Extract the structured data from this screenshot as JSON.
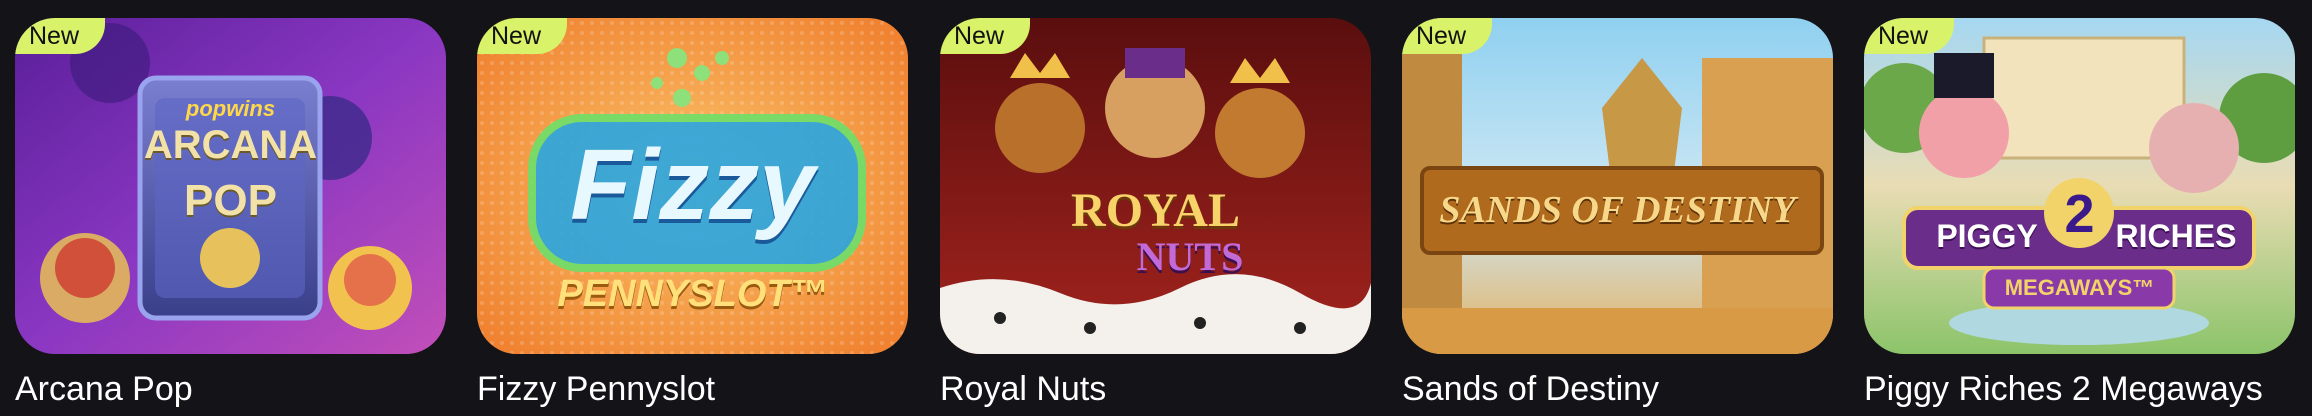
{
  "badge_label": "New",
  "games": [
    {
      "title": "Arcana Pop",
      "logo_top": "popwins",
      "logo_line1": "ARCANA",
      "logo_line2": "POP",
      "colors": {
        "bg1": "#6a2aa8",
        "bg2": "#c04fc9",
        "accent": "#e7c15b"
      }
    },
    {
      "title": "Fizzy Pennyslot",
      "logo_line1": "Fizzy",
      "logo_line2": "PENNYSLOT™",
      "colors": {
        "bg1": "#f7a23a",
        "bg2": "#f06b2a",
        "accent": "#2aa6e0"
      }
    },
    {
      "title": "Royal Nuts",
      "logo_line1": "ROYAL",
      "logo_line2": "NUTS",
      "colors": {
        "bg1": "#7a1010",
        "bg2": "#b8322a",
        "accent": "#f0c04a"
      }
    },
    {
      "title": "Sands of Destiny",
      "logo_line1": "SANDS OF DESTINY",
      "colors": {
        "bg1": "#7fc3ea",
        "bg2": "#d89a45",
        "accent": "#b06a1d"
      }
    },
    {
      "title": "Piggy Riches 2 Megaways",
      "logo_line1": "PIGGY",
      "logo_mid": "2",
      "logo_line2": "RICHES",
      "logo_line3": "MEGAWAYS™",
      "colors": {
        "bg1": "#8cc46a",
        "bg2": "#e7d2a0",
        "accent": "#6a2d8a"
      }
    }
  ]
}
